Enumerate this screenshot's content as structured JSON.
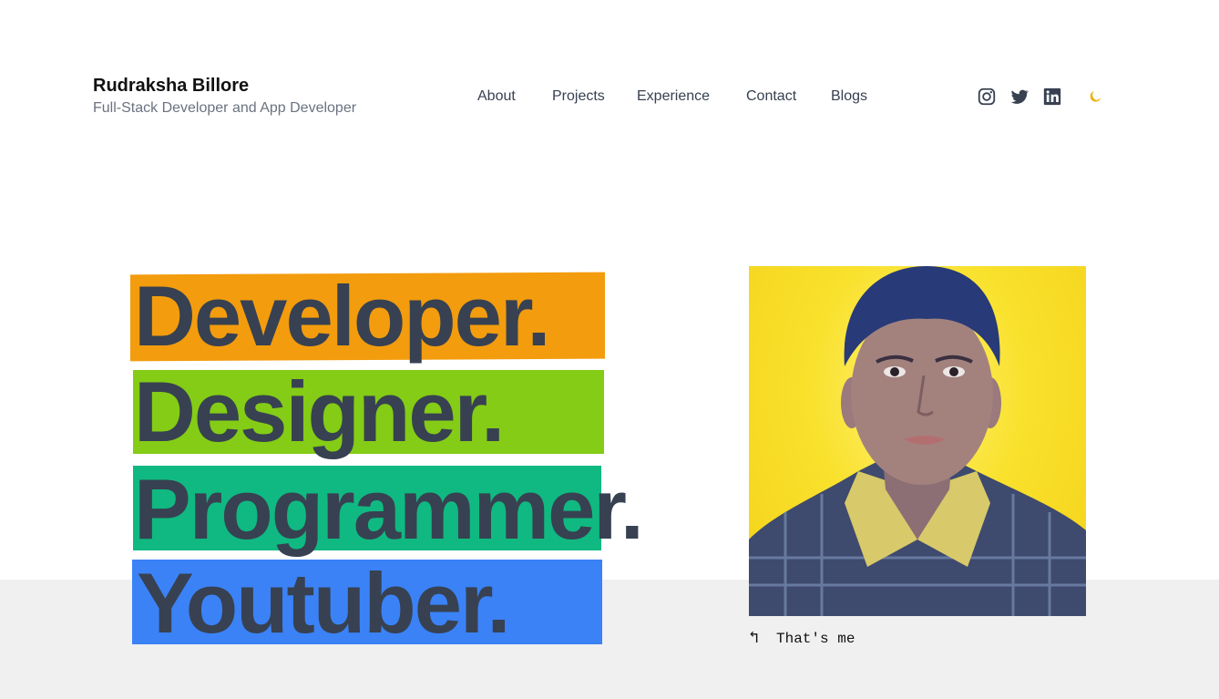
{
  "header": {
    "name": "Rudraksha Billore",
    "tagline": "Full-Stack Developer and App Developer"
  },
  "nav": {
    "items": [
      "About",
      "Projects",
      "Experience",
      "Contact",
      "Blogs"
    ]
  },
  "socials": {
    "icons": [
      "instagram-icon",
      "twitter-icon",
      "linkedin-icon",
      "moon-icon"
    ],
    "accent_moon": "#eab308"
  },
  "hero": {
    "words": [
      "Developer.",
      "Designer.",
      "Programmer.",
      "Youtuber."
    ],
    "highlight_colors": [
      "#f39c0e",
      "#84cc16",
      "#10b981",
      "#3b82f6"
    ]
  },
  "photo": {
    "caption": "That's me",
    "background_color": "#f9e12c"
  }
}
